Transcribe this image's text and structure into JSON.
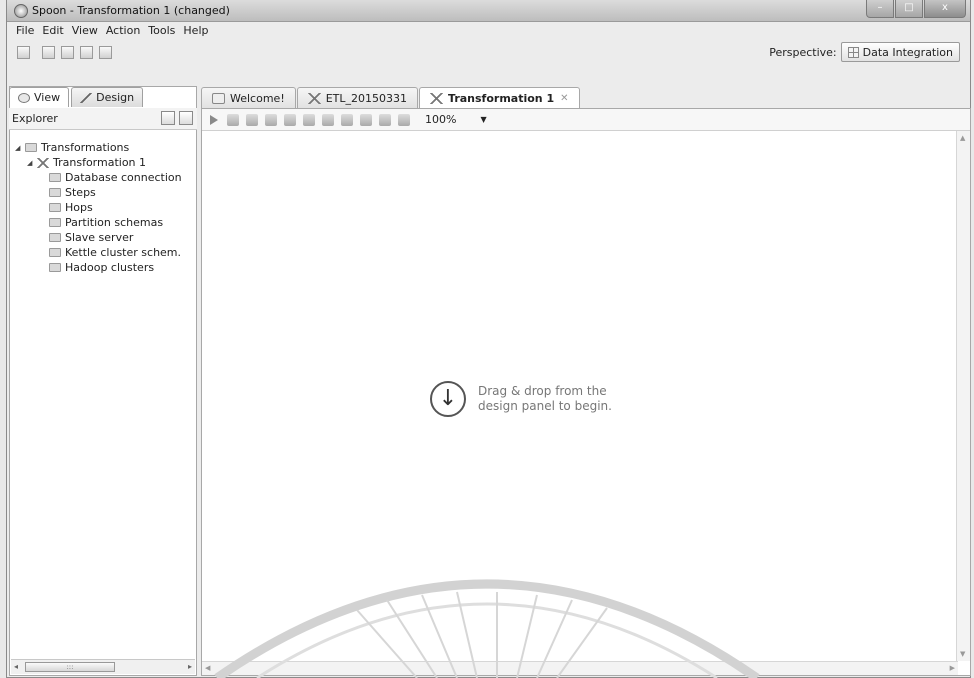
{
  "window": {
    "title": "Spoon - Transformation 1 (changed)",
    "controls": {
      "minimize": "–",
      "maximize": "□",
      "close": "x"
    }
  },
  "menu": [
    "File",
    "Edit",
    "View",
    "Action",
    "Tools",
    "Help"
  ],
  "perspective": {
    "label": "Perspective:",
    "value": "Data Integration"
  },
  "left_panel": {
    "tabs": [
      {
        "label": "View"
      },
      {
        "label": "Design"
      }
    ],
    "explorer_label": "Explorer",
    "tree": {
      "root": "Transformations",
      "child": "Transformation 1",
      "items": [
        "Database connection",
        "Steps",
        "Hops",
        "Partition schemas",
        "Slave server",
        "Kettle cluster schem.",
        "Hadoop clusters"
      ]
    },
    "scroll_thumb": ":::"
  },
  "editor": {
    "tabs": [
      {
        "label": "Welcome!",
        "icon": "welcome-icon"
      },
      {
        "label": "ETL_20150331",
        "icon": "transformation-icon"
      },
      {
        "label": "Transformation 1",
        "icon": "transformation-icon",
        "close": "✕"
      }
    ],
    "zoom": "100%",
    "hint_line1": "Drag & drop from the",
    "hint_line2": "design panel to begin."
  }
}
